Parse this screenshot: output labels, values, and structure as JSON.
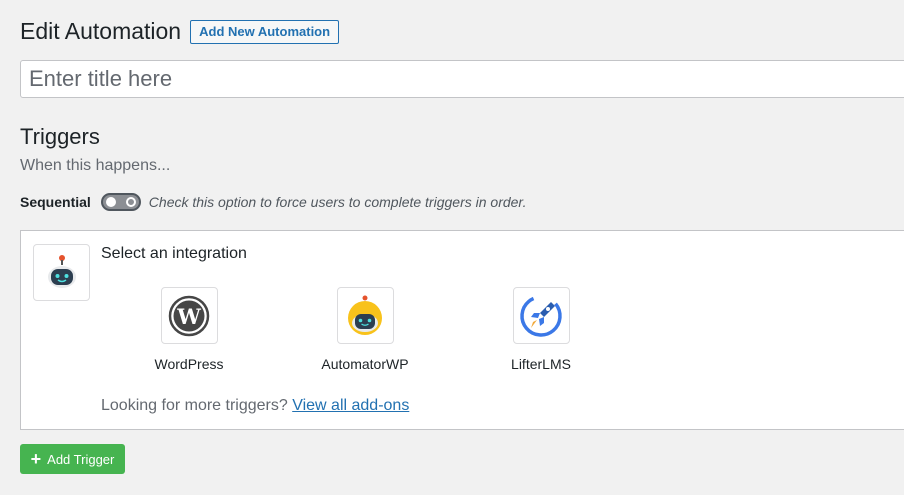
{
  "header": {
    "title": "Edit Automation",
    "add_new_label": "Add New Automation"
  },
  "title_input": {
    "placeholder": "Enter title here",
    "value": ""
  },
  "triggers": {
    "title": "Triggers",
    "subtitle": "When this happens...",
    "sequential_label": "Sequential",
    "sequential_on": false,
    "sequential_desc": "Check this option to force users to complete triggers in order.",
    "select_label": "Select an integration",
    "integrations": [
      {
        "label": "WordPress",
        "icon": "wordpress-icon"
      },
      {
        "label": "AutomatorWP",
        "icon": "automatorwp-robot-icon"
      },
      {
        "label": "LifterLMS",
        "icon": "lifterlms-rocket-icon"
      }
    ],
    "more_text": "Looking for more triggers? ",
    "more_link": "View all add-ons",
    "add_button": "Add Trigger"
  },
  "colors": {
    "accent_blue": "#2271b1",
    "add_green": "#46b450",
    "automatorwp_yellow": "#f8c21b"
  }
}
